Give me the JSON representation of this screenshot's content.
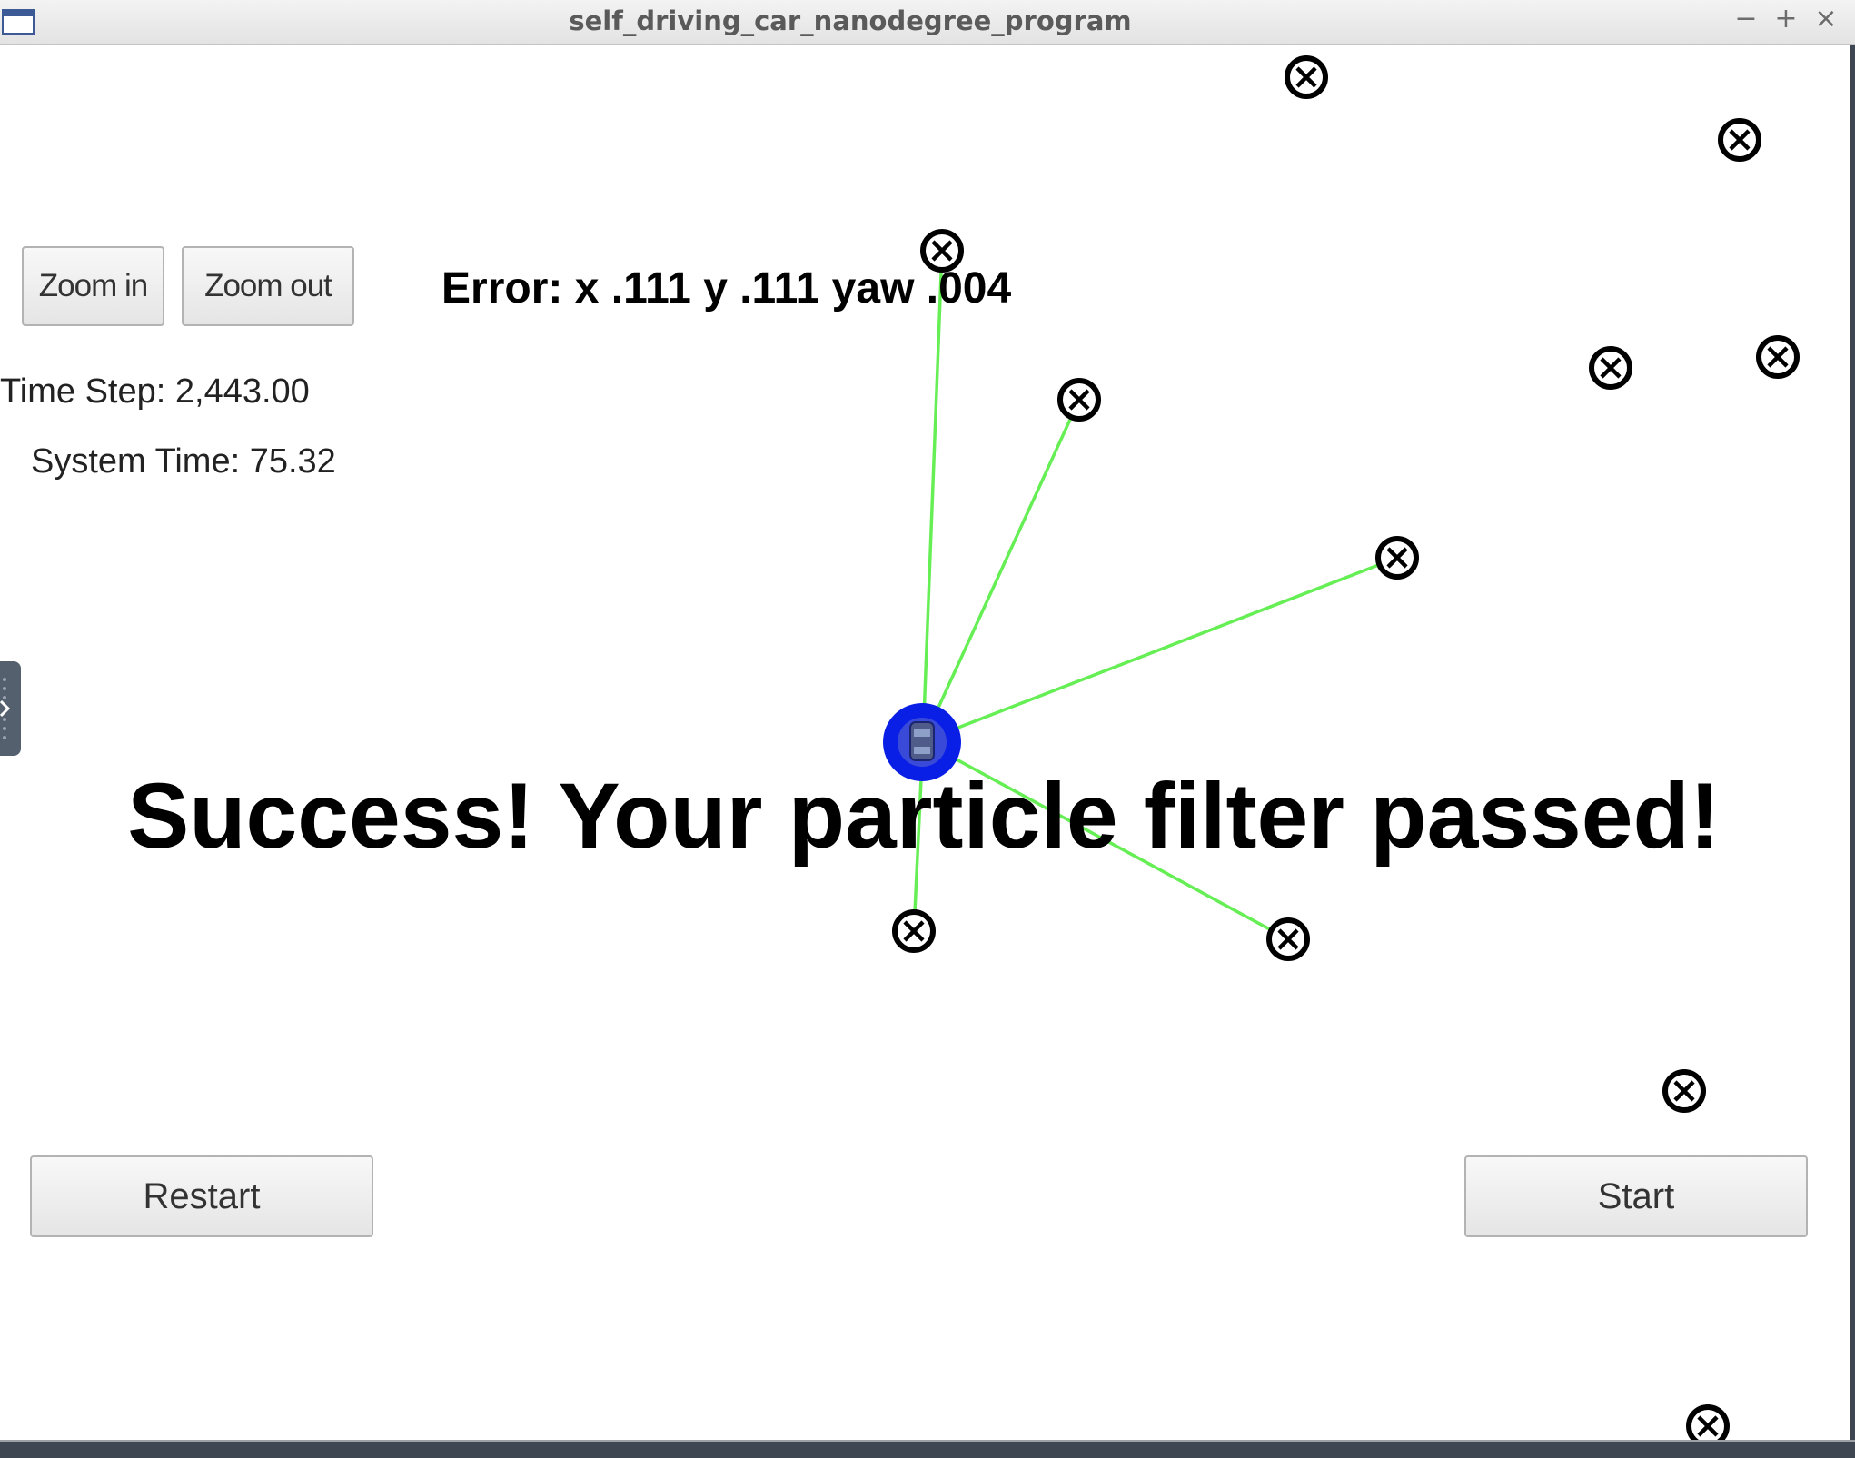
{
  "window": {
    "title": "self_driving_car_nanodegree_program",
    "controls": {
      "minimize": "−",
      "maximize": "+",
      "close": "×"
    }
  },
  "toolbar": {
    "zoom_in_label": "Zoom in",
    "zoom_out_label": "Zoom out"
  },
  "stats": {
    "time_step": "Time Step: 2,443.00",
    "system_time": "System Time: 75.32"
  },
  "error_text": "Error: x .111 y .111 yaw .004",
  "success_message": "Success! Your particle filter passed!",
  "controls": {
    "restart_label": "Restart",
    "start_label": "Start"
  },
  "colors": {
    "observation_line": "#66ee55",
    "vehicle": "#0a1fe6",
    "landmark": "#000000"
  },
  "icons": {
    "landmark": "circled-x-icon",
    "vehicle": "car-icon",
    "window": "window-icon"
  }
}
